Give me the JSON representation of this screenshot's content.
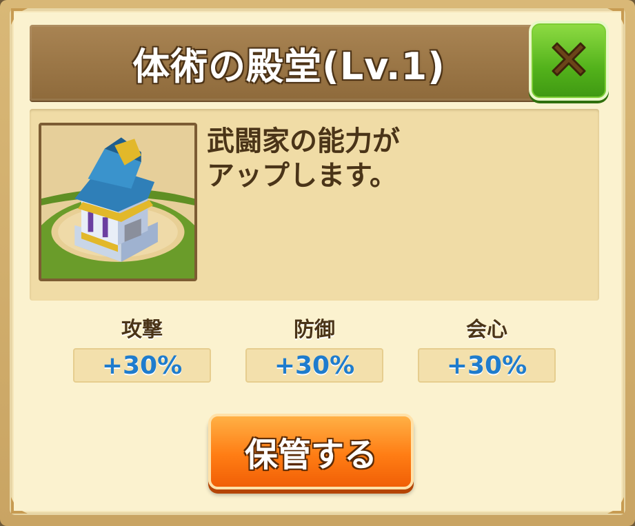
{
  "dialog": {
    "title": "体術の殿堂(Lv.1)",
    "close_icon": "close-x-icon",
    "description": "武闘家の能力が\nアップします。",
    "building_image": "hall-building-illustration"
  },
  "stats": [
    {
      "label": "攻撃",
      "value": "+30%"
    },
    {
      "label": "防御",
      "value": "+30%"
    },
    {
      "label": "会心",
      "value": "+30%"
    }
  ],
  "actions": {
    "store_label": "保管する"
  },
  "colors": {
    "title_bar": "#9c7847",
    "close_button": "#5cb81f",
    "panel": "#fbf2cf",
    "stat_value": "#1f7ccd",
    "store_button": "#ff7d14"
  }
}
